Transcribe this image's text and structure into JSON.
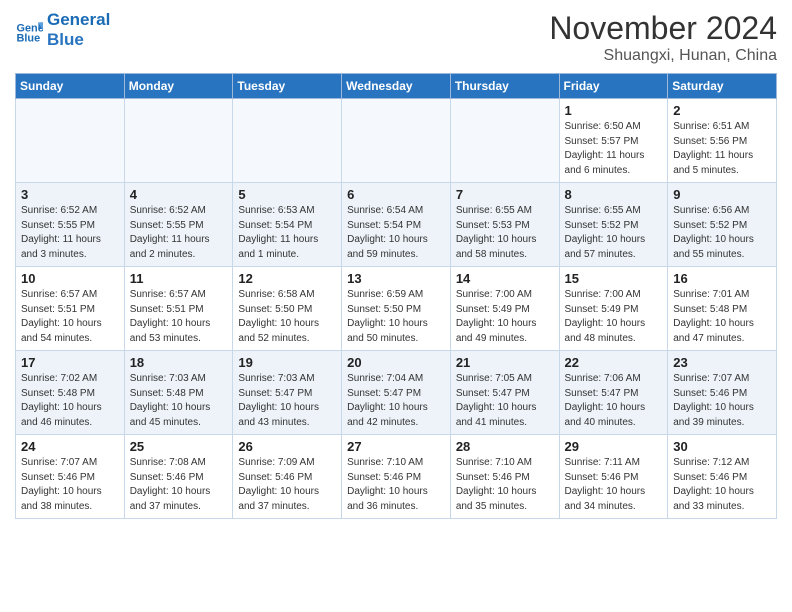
{
  "header": {
    "logo_line1": "General",
    "logo_line2": "Blue",
    "month": "November 2024",
    "location": "Shuangxi, Hunan, China"
  },
  "weekdays": [
    "Sunday",
    "Monday",
    "Tuesday",
    "Wednesday",
    "Thursday",
    "Friday",
    "Saturday"
  ],
  "weeks": [
    [
      {
        "day": "",
        "info": ""
      },
      {
        "day": "",
        "info": ""
      },
      {
        "day": "",
        "info": ""
      },
      {
        "day": "",
        "info": ""
      },
      {
        "day": "",
        "info": ""
      },
      {
        "day": "1",
        "info": "Sunrise: 6:50 AM\nSunset: 5:57 PM\nDaylight: 11 hours\nand 6 minutes."
      },
      {
        "day": "2",
        "info": "Sunrise: 6:51 AM\nSunset: 5:56 PM\nDaylight: 11 hours\nand 5 minutes."
      }
    ],
    [
      {
        "day": "3",
        "info": "Sunrise: 6:52 AM\nSunset: 5:55 PM\nDaylight: 11 hours\nand 3 minutes."
      },
      {
        "day": "4",
        "info": "Sunrise: 6:52 AM\nSunset: 5:55 PM\nDaylight: 11 hours\nand 2 minutes."
      },
      {
        "day": "5",
        "info": "Sunrise: 6:53 AM\nSunset: 5:54 PM\nDaylight: 11 hours\nand 1 minute."
      },
      {
        "day": "6",
        "info": "Sunrise: 6:54 AM\nSunset: 5:54 PM\nDaylight: 10 hours\nand 59 minutes."
      },
      {
        "day": "7",
        "info": "Sunrise: 6:55 AM\nSunset: 5:53 PM\nDaylight: 10 hours\nand 58 minutes."
      },
      {
        "day": "8",
        "info": "Sunrise: 6:55 AM\nSunset: 5:52 PM\nDaylight: 10 hours\nand 57 minutes."
      },
      {
        "day": "9",
        "info": "Sunrise: 6:56 AM\nSunset: 5:52 PM\nDaylight: 10 hours\nand 55 minutes."
      }
    ],
    [
      {
        "day": "10",
        "info": "Sunrise: 6:57 AM\nSunset: 5:51 PM\nDaylight: 10 hours\nand 54 minutes."
      },
      {
        "day": "11",
        "info": "Sunrise: 6:57 AM\nSunset: 5:51 PM\nDaylight: 10 hours\nand 53 minutes."
      },
      {
        "day": "12",
        "info": "Sunrise: 6:58 AM\nSunset: 5:50 PM\nDaylight: 10 hours\nand 52 minutes."
      },
      {
        "day": "13",
        "info": "Sunrise: 6:59 AM\nSunset: 5:50 PM\nDaylight: 10 hours\nand 50 minutes."
      },
      {
        "day": "14",
        "info": "Sunrise: 7:00 AM\nSunset: 5:49 PM\nDaylight: 10 hours\nand 49 minutes."
      },
      {
        "day": "15",
        "info": "Sunrise: 7:00 AM\nSunset: 5:49 PM\nDaylight: 10 hours\nand 48 minutes."
      },
      {
        "day": "16",
        "info": "Sunrise: 7:01 AM\nSunset: 5:48 PM\nDaylight: 10 hours\nand 47 minutes."
      }
    ],
    [
      {
        "day": "17",
        "info": "Sunrise: 7:02 AM\nSunset: 5:48 PM\nDaylight: 10 hours\nand 46 minutes."
      },
      {
        "day": "18",
        "info": "Sunrise: 7:03 AM\nSunset: 5:48 PM\nDaylight: 10 hours\nand 45 minutes."
      },
      {
        "day": "19",
        "info": "Sunrise: 7:03 AM\nSunset: 5:47 PM\nDaylight: 10 hours\nand 43 minutes."
      },
      {
        "day": "20",
        "info": "Sunrise: 7:04 AM\nSunset: 5:47 PM\nDaylight: 10 hours\nand 42 minutes."
      },
      {
        "day": "21",
        "info": "Sunrise: 7:05 AM\nSunset: 5:47 PM\nDaylight: 10 hours\nand 41 minutes."
      },
      {
        "day": "22",
        "info": "Sunrise: 7:06 AM\nSunset: 5:47 PM\nDaylight: 10 hours\nand 40 minutes."
      },
      {
        "day": "23",
        "info": "Sunrise: 7:07 AM\nSunset: 5:46 PM\nDaylight: 10 hours\nand 39 minutes."
      }
    ],
    [
      {
        "day": "24",
        "info": "Sunrise: 7:07 AM\nSunset: 5:46 PM\nDaylight: 10 hours\nand 38 minutes."
      },
      {
        "day": "25",
        "info": "Sunrise: 7:08 AM\nSunset: 5:46 PM\nDaylight: 10 hours\nand 37 minutes."
      },
      {
        "day": "26",
        "info": "Sunrise: 7:09 AM\nSunset: 5:46 PM\nDaylight: 10 hours\nand 37 minutes."
      },
      {
        "day": "27",
        "info": "Sunrise: 7:10 AM\nSunset: 5:46 PM\nDaylight: 10 hours\nand 36 minutes."
      },
      {
        "day": "28",
        "info": "Sunrise: 7:10 AM\nSunset: 5:46 PM\nDaylight: 10 hours\nand 35 minutes."
      },
      {
        "day": "29",
        "info": "Sunrise: 7:11 AM\nSunset: 5:46 PM\nDaylight: 10 hours\nand 34 minutes."
      },
      {
        "day": "30",
        "info": "Sunrise: 7:12 AM\nSunset: 5:46 PM\nDaylight: 10 hours\nand 33 minutes."
      }
    ]
  ]
}
